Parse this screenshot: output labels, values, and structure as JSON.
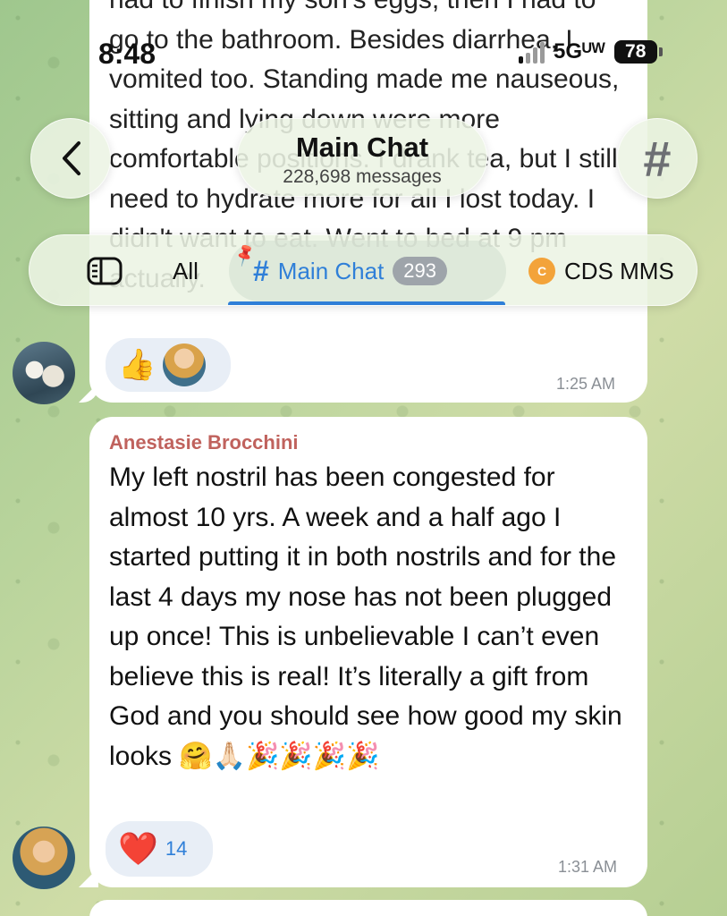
{
  "status_bar": {
    "time": "8:48",
    "network": "5Gᵁᵂ",
    "battery": "78"
  },
  "header": {
    "back_icon": "chevron-left-icon",
    "title": "Main Chat",
    "subtitle": "228,698 messages",
    "hash_icon": "#"
  },
  "tabs": {
    "all_label": "All",
    "main_label": "Main Chat",
    "main_count": "293",
    "cds_label": "CDS MMS",
    "cds_icon_letter": "C"
  },
  "messages": [
    {
      "text": "had to finish my son's eggs, then I had to go to the bathroom.  Besides diarrhea, I vomited too.  Standing made me nauseous, sitting and lying down were more comfortable positions.  I drank tea, but I still need to hydrate more for all I lost today.  I didn't want to eat. Went to bed at 9 pm actually.",
      "reaction_emoji": "👍",
      "time": "1:25 AM"
    },
    {
      "sender": "Anestasie Brocchini",
      "text": "My left nostril has been congested for almost 10 yrs. A week and a half ago I started putting it in both nostrils and for the last 4 days my nose has not been plugged up once! This is unbelievable I can’t even believe this is real! It’s literally a gift from God and you should see how good my skin looks 🤗🙏🏻🎉🎉🎉🎉",
      "reaction_emoji": "❤️",
      "reaction_count": "14",
      "time": "1:31 AM"
    }
  ],
  "colors": {
    "accent": "#2f7fd8",
    "sender": "#c0625d"
  }
}
